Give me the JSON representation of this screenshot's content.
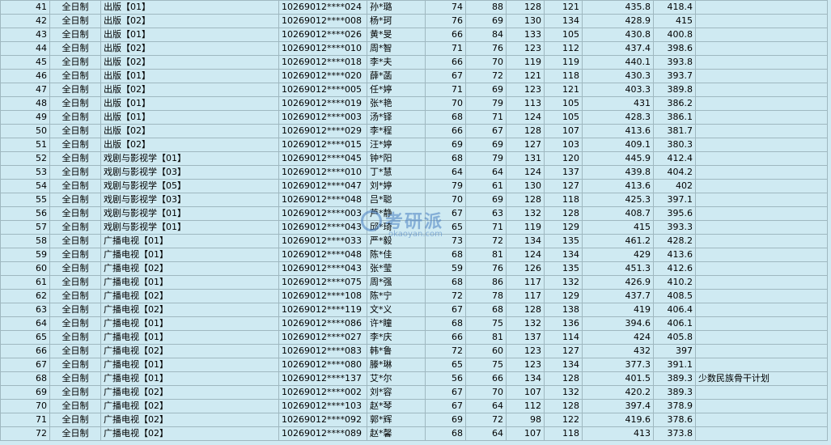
{
  "rows": [
    [
      "41",
      "全日制",
      "出版【01】",
      "10269012****024",
      "孙*璐",
      "74",
      "88",
      "128",
      "121",
      "435.8",
      "418.4",
      ""
    ],
    [
      "42",
      "全日制",
      "出版【02】",
      "10269012****008",
      "杨*珂",
      "76",
      "69",
      "130",
      "134",
      "428.9",
      "415",
      ""
    ],
    [
      "43",
      "全日制",
      "出版【01】",
      "10269012****026",
      "黄*旻",
      "66",
      "84",
      "133",
      "105",
      "430.8",
      "400.8",
      ""
    ],
    [
      "44",
      "全日制",
      "出版【02】",
      "10269012****010",
      "周*智",
      "71",
      "76",
      "123",
      "112",
      "437.4",
      "398.6",
      ""
    ],
    [
      "45",
      "全日制",
      "出版【02】",
      "10269012****018",
      "李*夫",
      "66",
      "70",
      "119",
      "119",
      "440.1",
      "393.8",
      ""
    ],
    [
      "46",
      "全日制",
      "出版【01】",
      "10269012****020",
      "薛*菡",
      "67",
      "72",
      "121",
      "118",
      "430.3",
      "393.7",
      ""
    ],
    [
      "47",
      "全日制",
      "出版【02】",
      "10269012****005",
      "任*婷",
      "71",
      "69",
      "123",
      "121",
      "403.3",
      "389.8",
      ""
    ],
    [
      "48",
      "全日制",
      "出版【01】",
      "10269012****019",
      "张*艳",
      "70",
      "79",
      "113",
      "105",
      "431",
      "386.2",
      ""
    ],
    [
      "49",
      "全日制",
      "出版【01】",
      "10269012****003",
      "汤*铎",
      "68",
      "71",
      "124",
      "105",
      "428.3",
      "386.1",
      ""
    ],
    [
      "50",
      "全日制",
      "出版【02】",
      "10269012****029",
      "李*程",
      "66",
      "67",
      "128",
      "107",
      "413.6",
      "381.7",
      ""
    ],
    [
      "51",
      "全日制",
      "出版【02】",
      "10269012****015",
      "汪*婷",
      "69",
      "69",
      "127",
      "103",
      "409.1",
      "380.3",
      ""
    ],
    [
      "52",
      "全日制",
      "戏剧与影视学【01】",
      "10269012****045",
      "钟*阳",
      "68",
      "79",
      "131",
      "120",
      "445.9",
      "412.4",
      ""
    ],
    [
      "53",
      "全日制",
      "戏剧与影视学【03】",
      "10269012****010",
      "丁*慧",
      "64",
      "64",
      "124",
      "137",
      "439.8",
      "404.2",
      ""
    ],
    [
      "54",
      "全日制",
      "戏剧与影视学【05】",
      "10269012****047",
      "刘*婷",
      "79",
      "61",
      "130",
      "127",
      "413.6",
      "402",
      ""
    ],
    [
      "55",
      "全日制",
      "戏剧与影视学【03】",
      "10269012****048",
      "吕*聪",
      "70",
      "69",
      "128",
      "118",
      "425.3",
      "397.1",
      ""
    ],
    [
      "56",
      "全日制",
      "戏剧与影视学【01】",
      "10269012****003",
      "芦*静",
      "67",
      "63",
      "132",
      "128",
      "408.7",
      "395.6",
      ""
    ],
    [
      "57",
      "全日制",
      "戏剧与影视学【01】",
      "10269012****043",
      "邱*琦",
      "65",
      "71",
      "119",
      "129",
      "415",
      "393.3",
      ""
    ],
    [
      "58",
      "全日制",
      "广播电视【01】",
      "10269012****033",
      "严*毅",
      "73",
      "72",
      "134",
      "135",
      "461.2",
      "428.2",
      ""
    ],
    [
      "59",
      "全日制",
      "广播电视【01】",
      "10269012****048",
      "陈*佳",
      "68",
      "81",
      "124",
      "134",
      "429",
      "413.6",
      ""
    ],
    [
      "60",
      "全日制",
      "广播电视【02】",
      "10269012****043",
      "张*莹",
      "59",
      "76",
      "126",
      "135",
      "451.3",
      "412.6",
      ""
    ],
    [
      "61",
      "全日制",
      "广播电视【01】",
      "10269012****075",
      "周*强",
      "68",
      "86",
      "117",
      "132",
      "426.9",
      "410.2",
      ""
    ],
    [
      "62",
      "全日制",
      "广播电视【02】",
      "10269012****108",
      "陈*宁",
      "72",
      "78",
      "117",
      "129",
      "437.7",
      "408.5",
      ""
    ],
    [
      "63",
      "全日制",
      "广播电视【02】",
      "10269012****119",
      "文*义",
      "67",
      "68",
      "128",
      "138",
      "419",
      "406.4",
      ""
    ],
    [
      "64",
      "全日制",
      "广播电视【01】",
      "10269012****086",
      "许*瞳",
      "68",
      "75",
      "132",
      "136",
      "394.6",
      "406.1",
      ""
    ],
    [
      "65",
      "全日制",
      "广播电视【01】",
      "10269012****027",
      "李*庆",
      "66",
      "81",
      "137",
      "114",
      "424",
      "405.8",
      ""
    ],
    [
      "66",
      "全日制",
      "广播电视【02】",
      "10269012****083",
      "韩*鲁",
      "72",
      "60",
      "123",
      "127",
      "432",
      "397",
      ""
    ],
    [
      "67",
      "全日制",
      "广播电视【01】",
      "10269012****080",
      "滕*琳",
      "65",
      "75",
      "123",
      "134",
      "377.3",
      "391.1",
      ""
    ],
    [
      "68",
      "全日制",
      "广播电视【01】",
      "10269012****137",
      "艾*尔",
      "56",
      "66",
      "134",
      "128",
      "401.5",
      "389.3",
      "少数民族骨干计划"
    ],
    [
      "69",
      "全日制",
      "广播电视【02】",
      "10269012****002",
      "刘*容",
      "67",
      "70",
      "107",
      "132",
      "420.2",
      "389.3",
      ""
    ],
    [
      "70",
      "全日制",
      "广播电视【02】",
      "10269012****103",
      "赵*琴",
      "67",
      "64",
      "112",
      "128",
      "397.4",
      "378.9",
      ""
    ],
    [
      "71",
      "全日制",
      "广播电视【02】",
      "10269012****092",
      "郭*辉",
      "69",
      "72",
      "98",
      "122",
      "419.6",
      "378.6",
      ""
    ],
    [
      "72",
      "全日制",
      "广播电视【02】",
      "10269012****089",
      "赵*馨",
      "68",
      "64",
      "107",
      "118",
      "413",
      "373.8",
      ""
    ]
  ],
  "watermark": {
    "title": "考研派",
    "url": "okaoyan.com",
    "icon": "logo-ring-icon"
  }
}
